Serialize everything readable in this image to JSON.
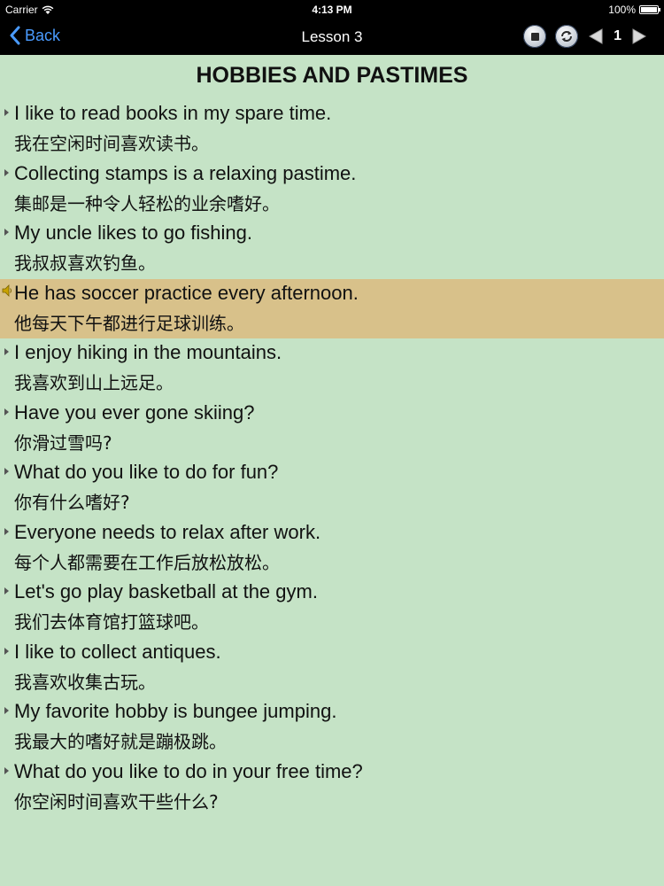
{
  "status_bar": {
    "carrier": "Carrier",
    "time": "4:13 PM",
    "battery": "100%",
    "battery_level": 1.0
  },
  "nav": {
    "back_label": "Back",
    "title": "Lesson 3",
    "page_number": "1",
    "back_icon": "chevron-left-icon",
    "stop_icon": "stop-icon",
    "repeat_icon": "repeat-icon",
    "prev_icon": "triangle-left-icon",
    "next_icon": "triangle-right-icon"
  },
  "colors": {
    "background": "#c5e3c6",
    "highlight": "#d8c18a",
    "nav_background": "#000000",
    "back_tint": "#4a9bff"
  },
  "page_title": "HOBBIES AND PASTIMES",
  "phrases": [
    {
      "en": "I like to read books in my spare time.",
      "zh": "我在空闲时间喜欢读书。",
      "active": false
    },
    {
      "en": "Collecting stamps is a relaxing pastime.",
      "zh": "集邮是一种令人轻松的业余嗜好。",
      "active": false
    },
    {
      "en": "My uncle likes to go fishing.",
      "zh": "我叔叔喜欢钓鱼。",
      "active": false
    },
    {
      "en": "He has soccer practice every afternoon.",
      "zh": "他每天下午都进行足球训练。",
      "active": true
    },
    {
      "en": "I enjoy hiking in the mountains.",
      "zh": "我喜欢到山上远足。",
      "active": false
    },
    {
      "en": "Have you ever gone skiing?",
      "zh": "你滑过雪吗?",
      "active": false
    },
    {
      "en": "What do you like to do for fun?",
      "zh": "你有什么嗜好?",
      "active": false
    },
    {
      "en": "Everyone needs to relax after work.",
      "zh": "每个人都需要在工作后放松放松。",
      "active": false
    },
    {
      "en": "Let's go play basketball at the gym.",
      "zh": "我们去体育馆打篮球吧。",
      "active": false
    },
    {
      "en": "I like to collect antiques.",
      "zh": "我喜欢收集古玩。",
      "active": false
    },
    {
      "en": "My favorite hobby is bungee jumping.",
      "zh": "我最大的嗜好就是蹦极跳。",
      "active": false
    },
    {
      "en": "What do you like to do in your free time?",
      "zh": "你空闲时间喜欢干些什么?",
      "active": false
    }
  ]
}
